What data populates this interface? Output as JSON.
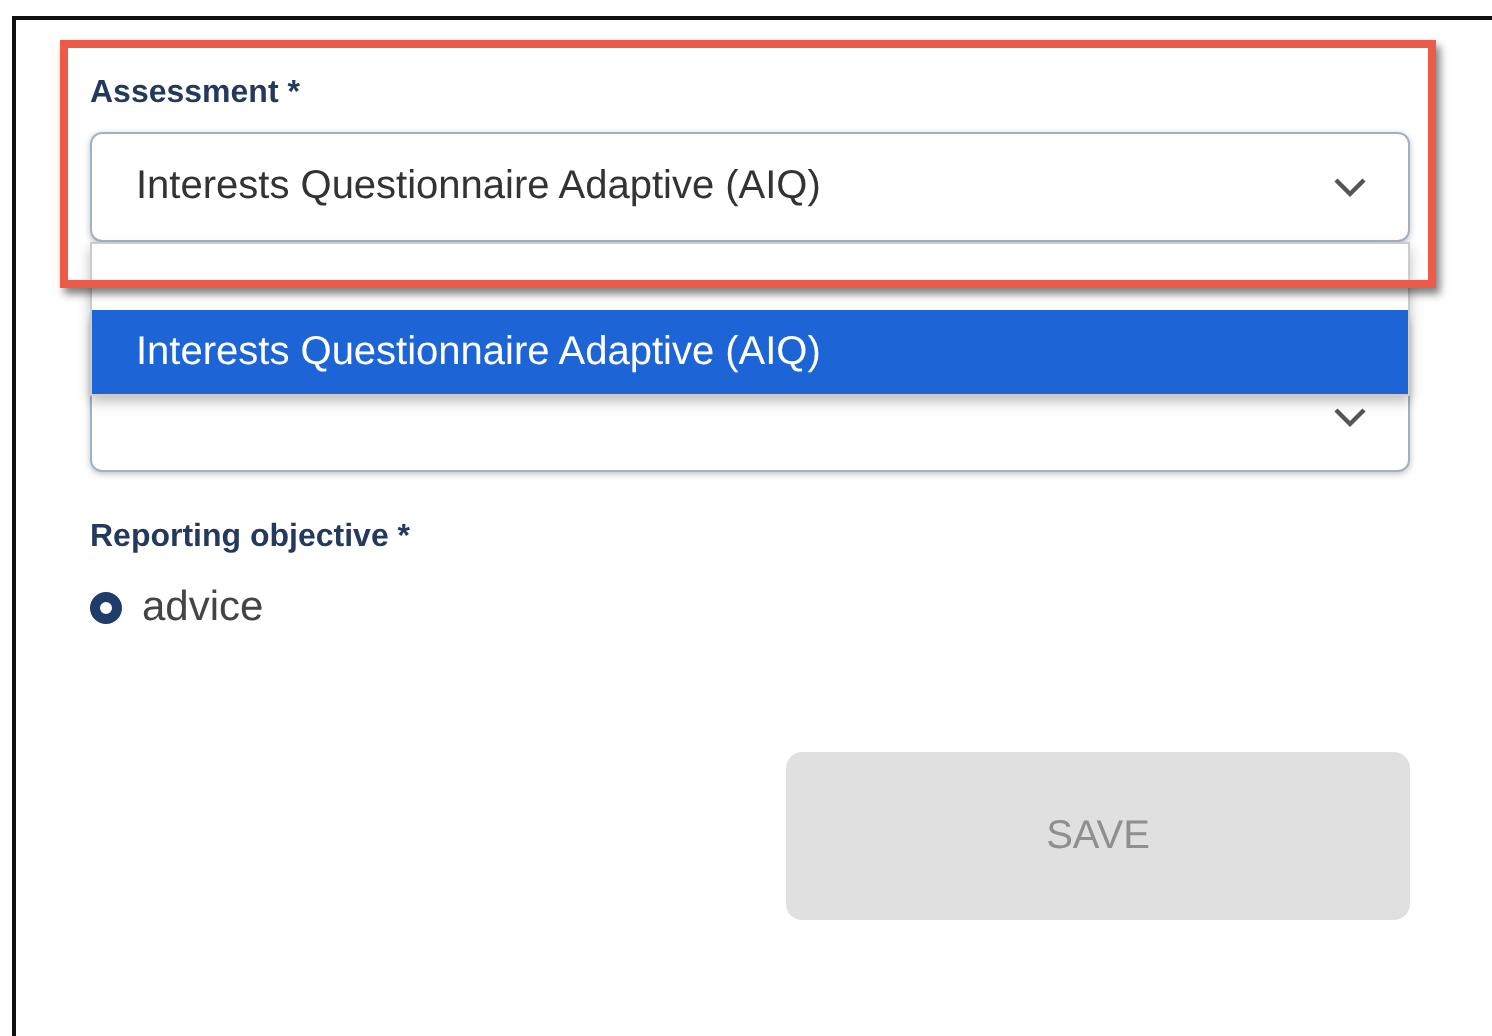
{
  "assessment": {
    "label": "Assessment *",
    "value": "Interests Questionnaire Adaptive (AIQ)",
    "expanded": true,
    "highlighted": true,
    "options": [
      {
        "label": "Interests Questionnaire Adaptive (AIQ)",
        "selected": true
      }
    ]
  },
  "reporting_objective": {
    "label": "Reporting objective *",
    "options": [
      {
        "label": "advice",
        "selected": true
      }
    ]
  },
  "save_button": {
    "label": "SAVE",
    "disabled": true
  }
}
